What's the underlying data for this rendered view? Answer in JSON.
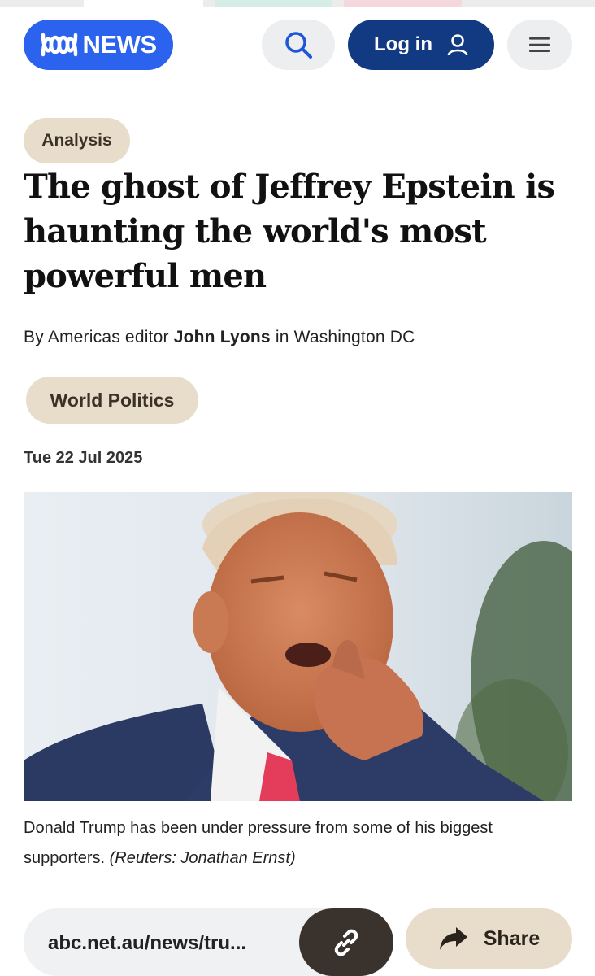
{
  "brand": {
    "logo_text": "NEWS",
    "accent_color": "#2c63ee",
    "login_color": "#113a82"
  },
  "header": {
    "search_icon": "search-icon",
    "login_label": "Log in",
    "user_icon": "user-icon",
    "menu_icon": "hamburger-menu-icon"
  },
  "article": {
    "label": "Analysis",
    "headline": "The ghost of Jeffrey Epstein is haunting the world's most powerful men",
    "byline_prefix": "By Americas editor",
    "author": "John Lyons",
    "byline_suffix": "in Washington DC",
    "topic": "World Politics",
    "date": "Tue 22 Jul 2025",
    "caption": "Donald Trump has been under pressure from some of his biggest supporters.",
    "credit": "(Reuters: Jonathan Ernst)"
  },
  "footer_bar": {
    "url": "abc.net.au/news/tru...",
    "copy_icon": "link-icon",
    "share_icon": "share-arrow-icon",
    "share_label": "Share"
  }
}
